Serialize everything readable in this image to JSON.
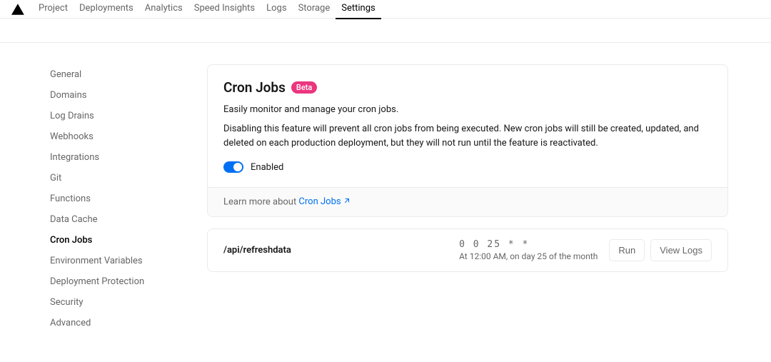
{
  "topnav": {
    "tabs": [
      {
        "label": "Project"
      },
      {
        "label": "Deployments"
      },
      {
        "label": "Analytics"
      },
      {
        "label": "Speed Insights"
      },
      {
        "label": "Logs"
      },
      {
        "label": "Storage"
      },
      {
        "label": "Settings"
      }
    ],
    "active_index": 6
  },
  "sidebar": {
    "items": [
      {
        "label": "General"
      },
      {
        "label": "Domains"
      },
      {
        "label": "Log Drains"
      },
      {
        "label": "Webhooks"
      },
      {
        "label": "Integrations"
      },
      {
        "label": "Git"
      },
      {
        "label": "Functions"
      },
      {
        "label": "Data Cache"
      },
      {
        "label": "Cron Jobs"
      },
      {
        "label": "Environment Variables"
      },
      {
        "label": "Deployment Protection"
      },
      {
        "label": "Security"
      },
      {
        "label": "Advanced"
      }
    ],
    "active_index": 8
  },
  "cron_card": {
    "title": "Cron Jobs",
    "badge": "Beta",
    "desc": "Easily monitor and manage your cron jobs.",
    "desc2": "Disabling this feature will prevent all cron jobs from being executed. New cron jobs will still be created, updated, and deleted on each production deployment, but they will not run until the feature is reactivated.",
    "toggle_label": "Enabled",
    "footer_prefix": "Learn more about ",
    "footer_link": "Cron Jobs"
  },
  "job": {
    "path": "/api/refreshdata",
    "cron": "0 0 25 * *",
    "human": "At 12:00 AM, on day 25 of the month",
    "run_label": "Run",
    "logs_label": "View Logs"
  }
}
